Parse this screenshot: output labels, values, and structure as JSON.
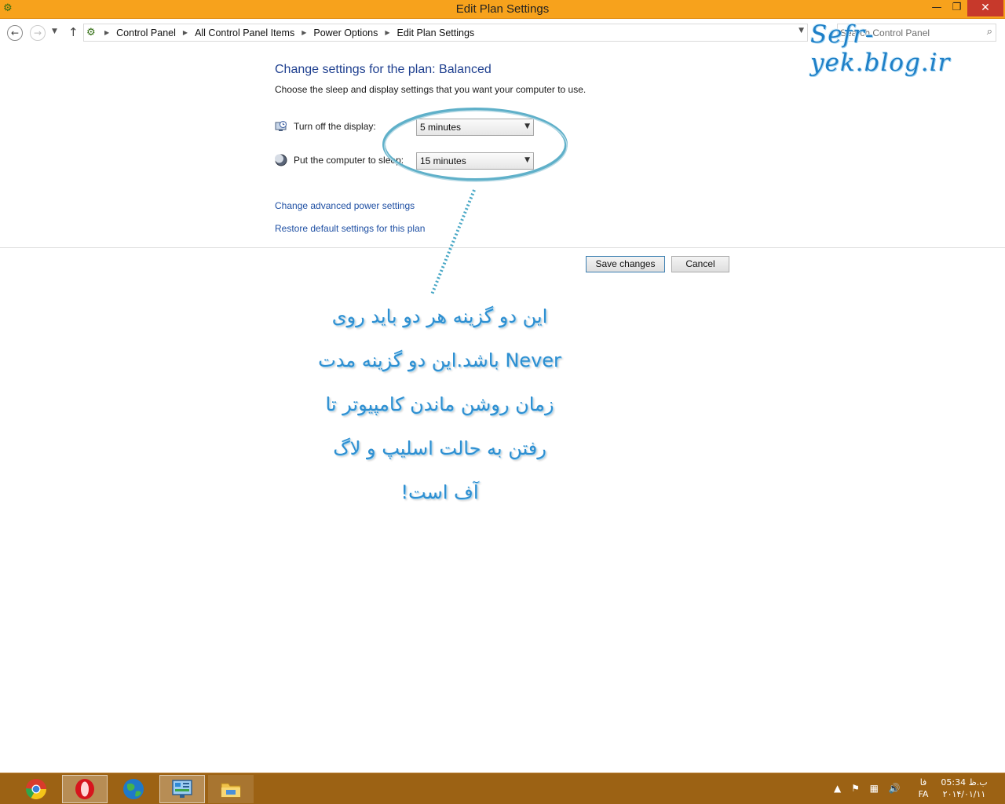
{
  "window": {
    "title": "Edit Plan Settings",
    "minimize": "—",
    "maximize": "❐",
    "close": "✕"
  },
  "address": {
    "crumbs": [
      "Control Panel",
      "All Control Panel Items",
      "Power Options",
      "Edit Plan Settings"
    ],
    "search_placeholder": "Search Control Panel"
  },
  "watermark": "Sefr-yek.blog.ir",
  "main": {
    "heading": "Change settings for the plan: Balanced",
    "subtext": "Choose the sleep and display settings that you want your computer to use.",
    "settings": [
      {
        "label": "Turn off the display:",
        "value": "5 minutes",
        "icon": "monitor-clock-icon"
      },
      {
        "label": "Put the computer to sleep:",
        "value": "15 minutes",
        "icon": "moon-icon"
      }
    ],
    "links": {
      "advanced": "Change advanced power settings",
      "restore": "Restore default settings for this plan"
    },
    "buttons": {
      "save": "Save changes",
      "cancel": "Cancel"
    }
  },
  "annotation": {
    "lines": [
      "این دو گزینه هر دو باید روی",
      "Never باشد.این دو گزینه مدت",
      "زمان روشن ماندن کامپیوتر تا",
      "رفتن به حالت اسلیپ و لاگ",
      "آف است!"
    ],
    "color": "#2e8fd1"
  },
  "taskbar": {
    "apps": [
      "chrome-icon",
      "opera-icon",
      "globe-icon",
      "control-panel-icon",
      "file-explorer-icon"
    ],
    "language_short": "فا",
    "language_code": "FA",
    "time": "ب.ظ 05:34",
    "date": "۲۰۱۴/۰۱/۱۱"
  },
  "colors": {
    "titlebar": "#f7a21c",
    "taskbar": "#9c6214",
    "link": "#1e4fa3",
    "heading": "#1e3f8f",
    "close_button": "#c7392b"
  }
}
